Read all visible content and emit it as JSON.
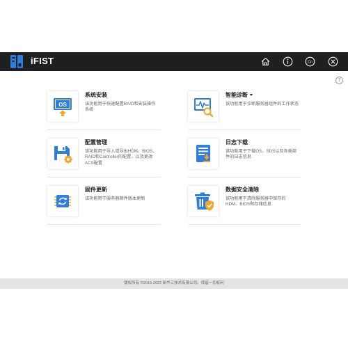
{
  "header": {
    "app_title": "iFIST",
    "icons": [
      "home-icon",
      "info-icon",
      "language-icon",
      "close-icon"
    ]
  },
  "help": {
    "label": "?"
  },
  "cards": [
    {
      "id": "system-install",
      "icon": "os-icon",
      "title": "系统安装",
      "desc": "该功能用于快速配置RAID和安装操作系统"
    },
    {
      "id": "smart-diagnosis",
      "icon": "diagnosis-icon",
      "title": "智能诊断",
      "desc": "该功能用于诊断服务器组件的工作状态"
    },
    {
      "id": "config-management",
      "icon": "config-icon",
      "title": "配置管理",
      "desc": "该功能用于导入或导出HDM、BIOS、RAID和Controller的配置，以及更改ACS配置"
    },
    {
      "id": "log-download",
      "icon": "log-icon",
      "title": "日志下载",
      "desc": "该功能用于下载OS、SDS以及各类部件的日志信息"
    },
    {
      "id": "firmware-update",
      "icon": "firmware-icon",
      "title": "固件更新",
      "desc": "该功能用于服务器固件版本更新"
    },
    {
      "id": "data-erase",
      "icon": "erase-icon",
      "title": "数据安全清除",
      "desc": "该功能用于清除服务器中保存的HDM、BIOS和存储信息"
    }
  ],
  "os_icon_label": "OS",
  "footer": {
    "text": "版权所有 ©2015-2022 新华三技术有限公司。保留一切权利"
  },
  "colors": {
    "header_bg": "#1f1f1f",
    "accent_blue": "#2f7de1",
    "accent_orange": "#f5a623",
    "footer_bg": "#e4e4e4"
  }
}
